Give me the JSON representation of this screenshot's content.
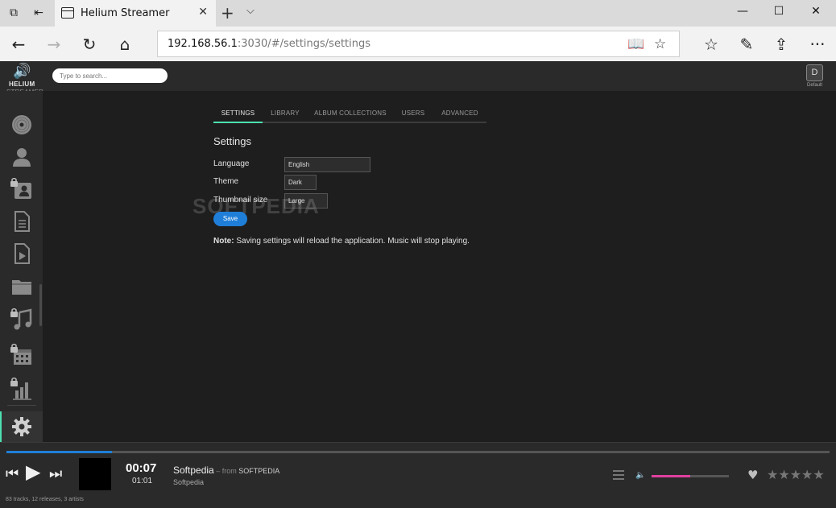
{
  "browser": {
    "tab_title": "Helium Streamer",
    "tab_close": "✕",
    "new_tab": "+",
    "tab_menu": "⌵",
    "url_host": "192.168.56.1",
    "url_rest": ":3030/#/settings/settings",
    "window": {
      "minimize": "—",
      "maximize": "☐",
      "close": "✕"
    },
    "nav": {
      "back": "←",
      "forward": "→",
      "refresh": "↻",
      "home": "⌂"
    },
    "toolbar": {
      "reading": "📖",
      "favorite": "☆",
      "favorites_hub": "☆",
      "notes": "✎",
      "share": "⇪",
      "more": "···"
    }
  },
  "app": {
    "logo_line1": "HELIUM",
    "logo_line2": "STREAMER",
    "search_placeholder": "Type to search...",
    "user_initial": "D",
    "user_label": "Default",
    "sidebar_items": [
      {
        "name": "vinyl-icon",
        "locked": false
      },
      {
        "name": "artist-icon",
        "locked": false
      },
      {
        "name": "contacts-icon",
        "locked": true
      },
      {
        "name": "document-icon",
        "locked": false
      },
      {
        "name": "video-file-icon",
        "locked": false
      },
      {
        "name": "folder-icon",
        "locked": false
      },
      {
        "name": "music-note-icon",
        "locked": true
      },
      {
        "name": "calendar-icon",
        "locked": true
      },
      {
        "name": "stats-icon",
        "locked": true
      },
      {
        "name": "gear-icon",
        "locked": false,
        "active": true
      }
    ],
    "accent": "#4de0b0",
    "tabs": [
      "SETTINGS",
      "LIBRARY",
      "ALBUM COLLECTIONS",
      "USERS",
      "ADVANCED"
    ],
    "active_tab": "SETTINGS",
    "heading": "Settings",
    "fields": [
      {
        "label": "Language",
        "value": "English"
      },
      {
        "label": "Theme",
        "value": "Dark"
      },
      {
        "label": "Thumbnail size",
        "value": "Large"
      }
    ],
    "save_label": "Save",
    "note_bold": "Note:",
    "note_text": " Saving settings will reload the application. Music will stop playing.",
    "watermark": "SOFTPEDIA"
  },
  "player": {
    "elapsed": "00:07",
    "total": "01:01",
    "track_title": "Softpedia",
    "from_text": " – from ",
    "album": "SOFTPEDIA",
    "artist": "Softpedia",
    "library_stats": "83 tracks, 12 releases, 3 artists",
    "progress_fraction": 0.128,
    "volume_fraction": 0.5,
    "progress_color": "#1f7fd8",
    "volume_color": "#e040a0",
    "stars": "★★★★★",
    "heart": "♥",
    "prev": "⏮",
    "play": "▶",
    "next": "⏭",
    "volume_icon": "🔈"
  }
}
